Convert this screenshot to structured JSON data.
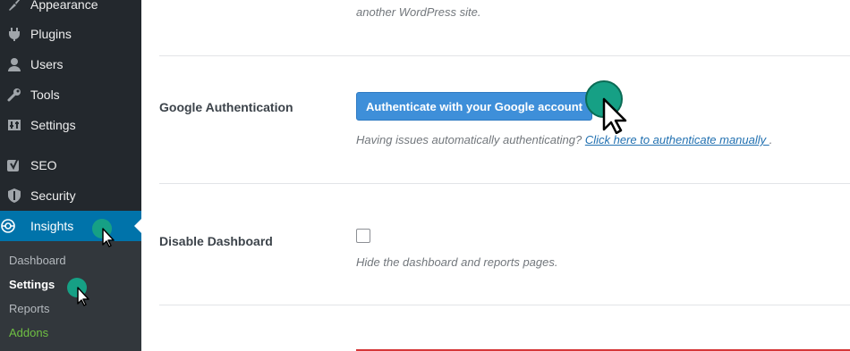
{
  "sidebar": {
    "items": [
      {
        "label": "Appearance",
        "icon": "paintbrush-icon"
      },
      {
        "label": "Plugins",
        "icon": "plugin-icon"
      },
      {
        "label": "Users",
        "icon": "user-icon"
      },
      {
        "label": "Tools",
        "icon": "wrench-icon"
      },
      {
        "label": "Settings",
        "icon": "settings-icon"
      },
      {
        "label": "SEO",
        "icon": "yoast-icon"
      },
      {
        "label": "Security",
        "icon": "shield-icon"
      },
      {
        "label": "Insights",
        "icon": "insights-icon"
      }
    ],
    "submenu": [
      {
        "label": "Dashboard"
      },
      {
        "label": "Settings"
      },
      {
        "label": "Reports"
      },
      {
        "label": "Addons"
      }
    ]
  },
  "content": {
    "top_text": "another WordPress site.",
    "google_auth": {
      "label": "Google Authentication",
      "button": "Authenticate with your Google account",
      "help_prefix": "Having issues automatically authenticating? ",
      "help_link": "Click here to authenticate manually ",
      "help_suffix": "."
    },
    "dashboard": {
      "label": "Disable Dashboard",
      "checked": false,
      "help": "Hide the dashboard and reports pages."
    }
  },
  "colors": {
    "sidebar_bg": "#23282d",
    "submenu_bg": "#32373c",
    "active_bg": "#0073aa",
    "button_bg": "#3e8fd9",
    "cursor_dot": "#16a085",
    "addons_green": "#6fc043"
  }
}
